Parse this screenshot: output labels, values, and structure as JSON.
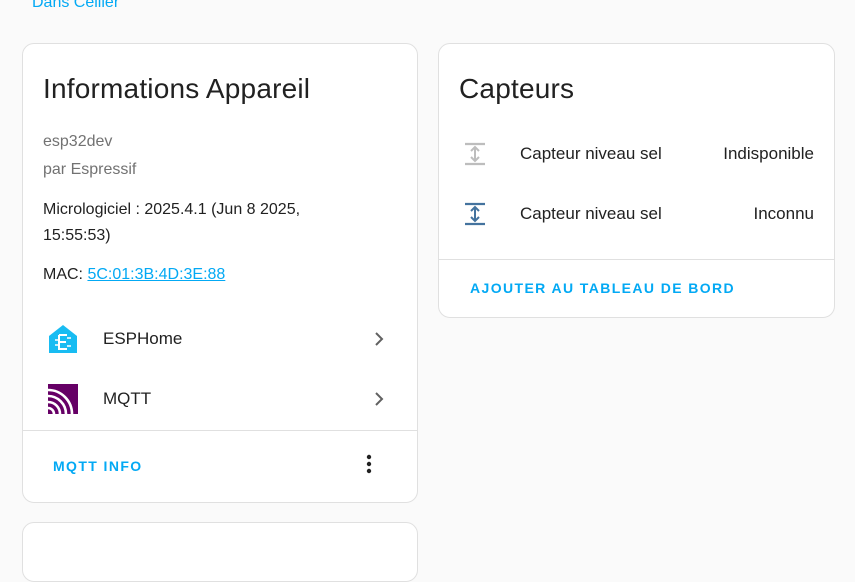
{
  "breadcrumb": {
    "area_link": "Dans Cellier"
  },
  "device_info": {
    "title": "Informations Appareil",
    "model": "esp32dev",
    "manufacturer": "par Espressif",
    "firmware_line1": "Micrologiciel : 2025.4.1 (Jun 8 2025,",
    "firmware_line2": "15:55:53)",
    "mac_label": "MAC: ",
    "mac_value": "5C:01:3B:4D:3E:88",
    "integrations": [
      {
        "label": "ESPHome",
        "icon": "esphome-icon"
      },
      {
        "label": "MQTT",
        "icon": "mqtt-icon"
      }
    ],
    "action_label": "MQTT INFO"
  },
  "sensors": {
    "title": "Capteurs",
    "items": [
      {
        "name": "Capteur niveau sel",
        "state": "Indisponible",
        "icon": "arrow-expand-vertical-icon",
        "icon_color": "#bdbdbd"
      },
      {
        "name": "Capteur niveau sel",
        "state": "Inconnu",
        "icon": "arrow-expand-vertical-icon",
        "icon_color": "#44739e"
      }
    ],
    "action_label": "AJOUTER AU TABLEAU DE BORD"
  },
  "colors": {
    "accent": "#03a9f4",
    "esphome": "#18bcf2",
    "mqtt": "#660066"
  }
}
